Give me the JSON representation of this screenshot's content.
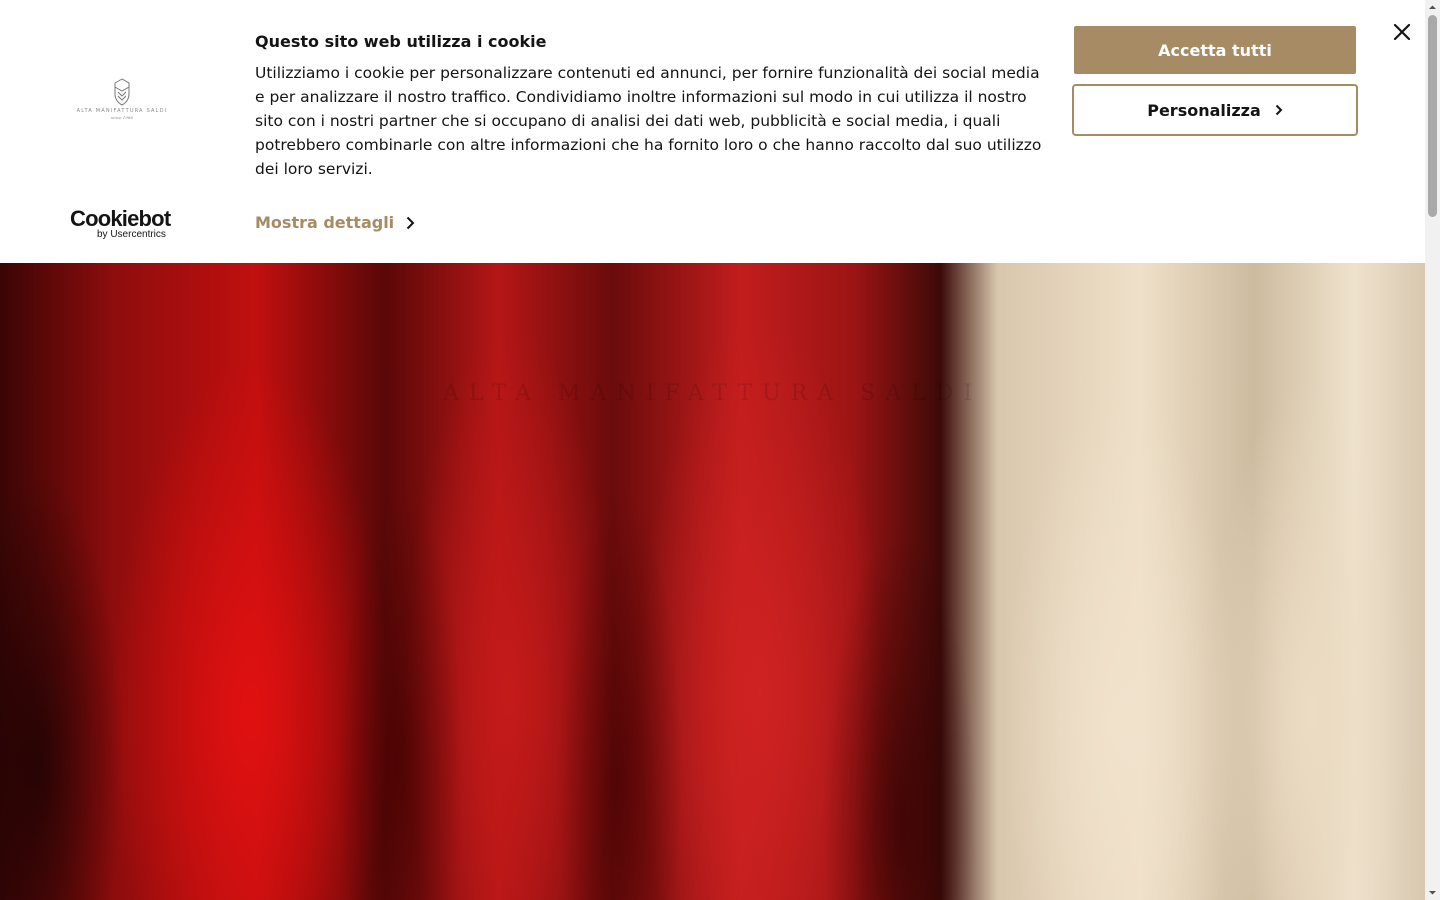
{
  "banner": {
    "title": "Questo sito web utilizza i cookie",
    "text": "Utilizziamo i cookie per personalizzare contenuti ed annunci, per fornire funzionalità dei social media e per analizzare il nostro traffico. Condividiamo inoltre informazioni sul modo in cui utilizza il nostro sito con i nostri partner che si occupano di analisi dei dati web, pubblicità e social media, i quali potrebbero combinarle con altre informazioni che ha fornito loro o che hanno raccolto dal suo utilizzo dei loro servizi.",
    "details_link": "Mostra dettagli",
    "accept_label": "Accetta tutti",
    "customize_label": "Personalizza",
    "close_icon": "close-icon"
  },
  "brand": {
    "name": "ALTA MANIFATTURA SALDI",
    "since": "since 1986"
  },
  "cookiebot": {
    "word": "Cookiebot",
    "by": "by Usercentrics"
  },
  "hero": {
    "watermark": "ALTA MANIFATTURA SALDI"
  },
  "colors": {
    "accent": "#a68b65",
    "text": "#141414",
    "banner_bg": "#ffffff"
  }
}
